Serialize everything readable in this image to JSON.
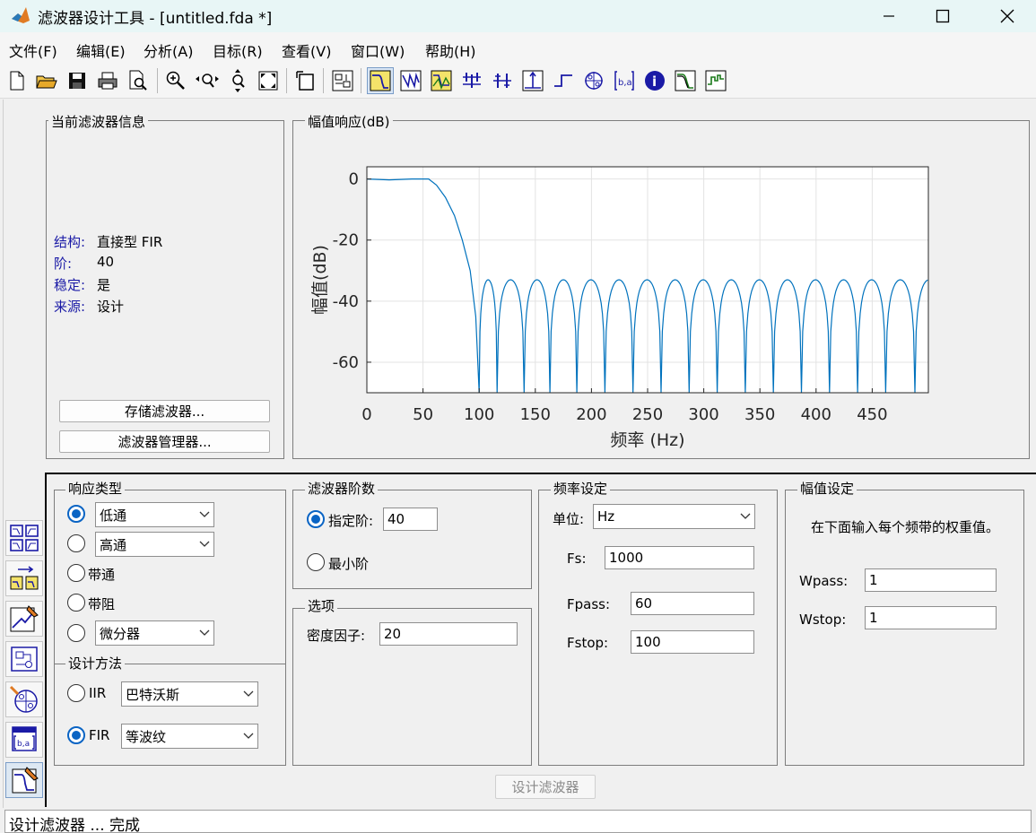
{
  "window": {
    "title": "滤波器设计工具 -  [untitled.fda *]",
    "controls": [
      "minimize",
      "maximize",
      "close"
    ]
  },
  "menu": [
    "文件(F)",
    "编辑(E)",
    "分析(A)",
    "目标(R)",
    "查看(V)",
    "窗口(W)",
    "帮助(H)"
  ],
  "toolbar": {
    "icons": [
      "new-file-icon",
      "open-folder-icon",
      "save-icon",
      "print-icon",
      "print-preview-icon",
      "zoom-in-icon",
      "zoom-x-icon",
      "zoom-y-icon",
      "full-view-icon",
      "new-window-icon",
      "filter-structure-icon",
      "magnitude-response-icon",
      "phase-response-icon",
      "magnitude-phase-icon",
      "group-delay-icon",
      "phase-delay-icon",
      "impulse-response-icon",
      "step-response-icon",
      "pole-zero-icon",
      "coefficients-icon",
      "filter-info-icon",
      "magnitude-estimate-icon",
      "round-off-noise-icon"
    ],
    "active": "magnitude-response-icon"
  },
  "left_strip": {
    "icons": [
      "transform-filter-icon",
      "multirate-icon",
      "pole-zero-editor-icon",
      "realize-model-icon",
      "import-filter-icon",
      "set-quantization-icon",
      "design-filter-icon"
    ],
    "active": "design-filter-icon"
  },
  "info_panel": {
    "title": "当前滤波器信息",
    "rows": [
      {
        "key": "结构:",
        "value": "直接型 FIR"
      },
      {
        "key": "阶:",
        "value": "40"
      },
      {
        "key": "稳定:",
        "value": "是"
      },
      {
        "key": "来源:",
        "value": "设计"
      }
    ],
    "store_button": "存储滤波器...",
    "manager_button": "滤波器管理器..."
  },
  "plot_panel": {
    "title": "幅值响应(dB)"
  },
  "chart_data": {
    "type": "line",
    "xlabel": "频率 (Hz)",
    "ylabel": "幅值(dB)",
    "xlim": [
      0,
      500
    ],
    "ylim": [
      -70,
      4
    ],
    "xticks": [
      0,
      50,
      100,
      150,
      200,
      250,
      300,
      350,
      400,
      450
    ],
    "yticks": [
      0,
      -20,
      -40,
      -60
    ],
    "grid": true,
    "series_color": "#0072bd",
    "passband": {
      "x": [
        0,
        20,
        40,
        55,
        62,
        70,
        78,
        85,
        92,
        97,
        100
      ],
      "y": [
        0,
        -0.3,
        0,
        0,
        -2,
        -6,
        -12,
        -20,
        -30,
        -45,
        -70
      ]
    },
    "stopband_ripple_db": -33,
    "stopband_nulls_hz": [
      100,
      116,
      140,
      163,
      187,
      212,
      237,
      262,
      287,
      312,
      337,
      362,
      387,
      412,
      437,
      462,
      488
    ]
  },
  "response_type": {
    "title": "响应类型",
    "options": [
      {
        "label": "低通",
        "type": "select",
        "checked": true
      },
      {
        "label": "高通",
        "type": "select",
        "checked": false
      },
      {
        "label": "带通",
        "type": "plain",
        "checked": false
      },
      {
        "label": "带阻",
        "type": "plain",
        "checked": false
      },
      {
        "label": "微分器",
        "type": "select",
        "checked": false
      }
    ]
  },
  "design_method": {
    "title": "设计方法",
    "options": [
      {
        "label": "IIR",
        "select": "巴特沃斯",
        "checked": false
      },
      {
        "label": "FIR",
        "select": "等波纹",
        "checked": true
      }
    ]
  },
  "filter_order": {
    "title": "滤波器阶数",
    "specify_label": "指定阶:",
    "specify_value": "40",
    "minimum_label": "最小阶"
  },
  "options": {
    "title": "选项",
    "density_label": "密度因子:",
    "density_value": "20"
  },
  "freq_specs": {
    "title": "频率设定",
    "units_label": "单位:",
    "units_value": "Hz",
    "fs_label": "Fs:",
    "fs_value": "1000",
    "fpass_label": "Fpass:",
    "fpass_value": "60",
    "fstop_label": "Fstop:",
    "fstop_value": "100"
  },
  "mag_specs": {
    "title": "幅值设定",
    "description": "在下面输入每个频带的权重值。",
    "wpass_label": "Wpass:",
    "wpass_value": "1",
    "wstop_label": "Wstop:",
    "wstop_value": "1"
  },
  "design_button": "设计滤波器",
  "status": "设计滤波器 ... 完成"
}
